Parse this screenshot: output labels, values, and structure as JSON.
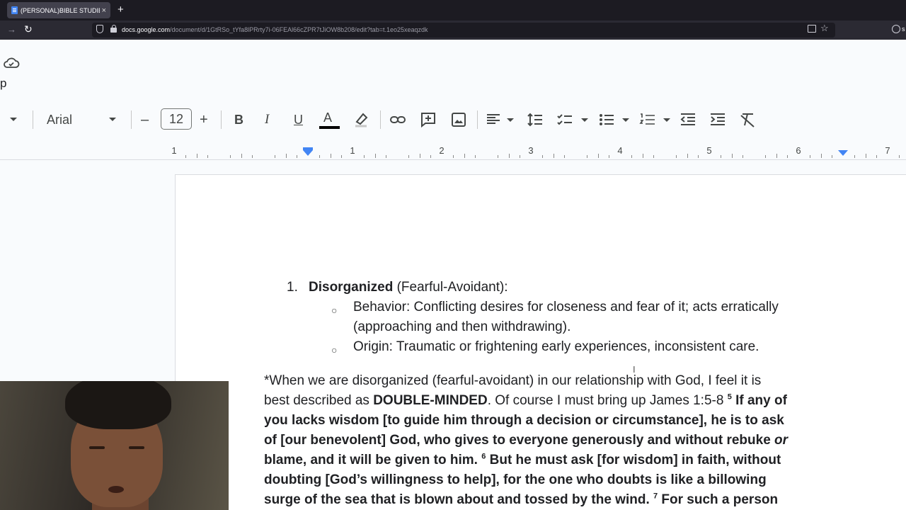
{
  "browser": {
    "tab_title": "(PERSONAL)BIBLE STUDIES WIT",
    "tab_close": "×",
    "new_tab": "+",
    "url_domain": "docs.google.com",
    "url_path": "/document/d/1GtRSo_tYfa8lPRrty7i-06FEAl66cZPR7tJiOW8b208/edit?tab=t.1eo25xeaqzdk",
    "account_text": "s"
  },
  "docs_header": {
    "menu_fragment": "p",
    "icon_cloud": "cloud-check-icon"
  },
  "toolbar": {
    "font_name": "Arial",
    "font_size": "12",
    "minus": "–",
    "plus": "+",
    "bold": "B",
    "italic": "I",
    "underline": "U",
    "text_color_letter": "A",
    "text_color": "#000000"
  },
  "ruler": {
    "numbers": [
      "1",
      "1",
      "2",
      "3",
      "4",
      "5",
      "6",
      "7"
    ]
  },
  "document": {
    "list_number": "1.",
    "item_title": "Disorganized",
    "item_subtitle": " (Fearful-Avoidant):",
    "bullet": "○",
    "behavior_line1": "Behavior: Conflicting desires for closeness and fear of it; acts erratically",
    "behavior_line2": "(approaching and then withdrawing).",
    "origin_line": "Origin: Traumatic or frightening early experiences, inconsistent care.",
    "p1_line1": "*When we are disorganized (fearful-avoidant) in our relationship with God, I feel it is",
    "p1_line2_a": "best described as ",
    "p1_line2_b": "DOUBLE-MINDED",
    "p1_line2_c": ". Of course I must bring up James 1:5-8 ",
    "sup5": "5",
    "p1_line2_d": " If any of",
    "p1_line3": "you lacks wisdom [to guide him through a decision or circumstance], he is to ask",
    "p1_line4_a": "of [our benevolent] God, who gives to everyone generously and without rebuke ",
    "p1_line4_b": "or",
    "p1_line5_a": "blame, and it will be given to him. ",
    "sup6": "6",
    "p1_line5_b": " But he must ask [for wisdom] in faith, without",
    "p1_line6": "doubting [God’s willingness to help], for the one who doubts is like a billowing",
    "p1_line7_a": "surge of the sea that is blown about and tossed by the wind. ",
    "sup7": "7",
    "p1_line7_b": " For such a person"
  },
  "colors": {
    "accent_blue": "#4285f4",
    "tab_bg": "#42414d",
    "chrome_bg": "#1c1b22"
  }
}
